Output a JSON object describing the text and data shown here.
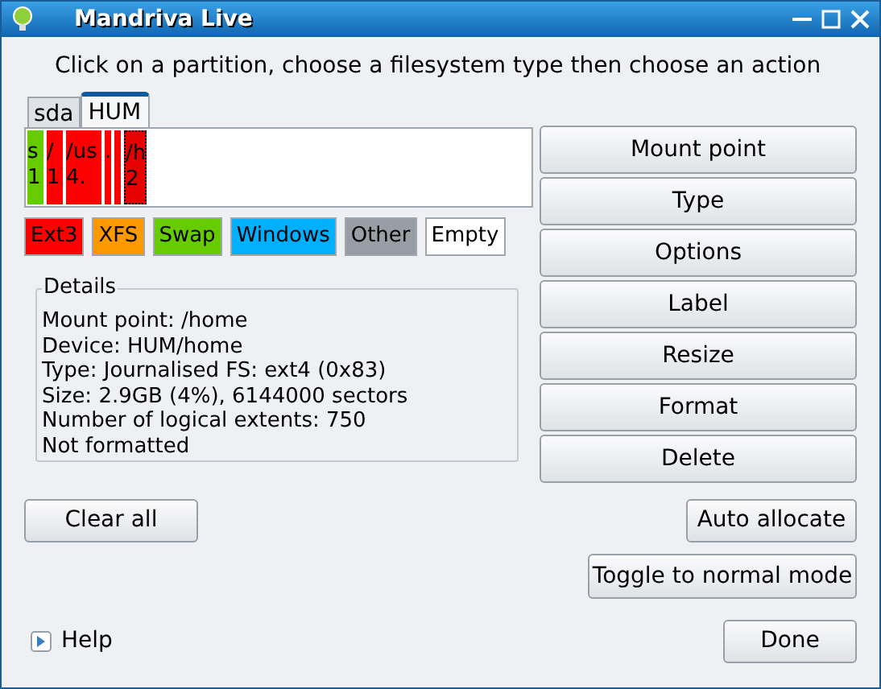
{
  "window": {
    "title": "Mandriva Live"
  },
  "instruction": "Click on a partition, choose a filesystem type then choose an action",
  "tabs": [
    {
      "label": "sda",
      "selected": false
    },
    {
      "label": "HUM",
      "selected": true
    }
  ],
  "partitions": [
    {
      "kind": "swap",
      "lines": [
        "s",
        "1"
      ],
      "selected": false
    },
    {
      "kind": "ext3",
      "lines": [
        "/",
        "1"
      ],
      "selected": false
    },
    {
      "kind": "ext3",
      "lines": [
        "/us",
        "4."
      ],
      "selected": false
    },
    {
      "kind": "ext3",
      "lines": [
        "."
      ],
      "selected": false
    },
    {
      "kind": "ext3",
      "selected": false
    },
    {
      "kind": "ext3",
      "lines": [
        "/h",
        "2"
      ],
      "selected": true
    }
  ],
  "legend": [
    {
      "label": "Ext3",
      "color": "#ff0000"
    },
    {
      "label": "XFS",
      "color": "#ff9900"
    },
    {
      "label": "Swap",
      "color": "#66cc00"
    },
    {
      "label": "Windows",
      "color": "#00b0ff"
    },
    {
      "label": "Other",
      "color": "#999ea6"
    },
    {
      "label": "Empty",
      "color": "#ffffff"
    }
  ],
  "details": {
    "title": "Details",
    "lines": [
      "Mount point: /home",
      "Device: HUM/home",
      "Type: Journalised FS: ext4 (0x83)",
      "Size: 2.9GB (4%), 6144000 sectors",
      "Number of logical extents: 750",
      "Not formatted"
    ]
  },
  "actions": [
    "Mount point",
    "Type",
    "Options",
    "Label",
    "Resize",
    "Format",
    "Delete"
  ],
  "buttons": {
    "clear_all": "Clear all",
    "auto_allocate": "Auto allocate",
    "toggle": "Toggle to normal mode",
    "help": "Help",
    "done": "Done"
  }
}
